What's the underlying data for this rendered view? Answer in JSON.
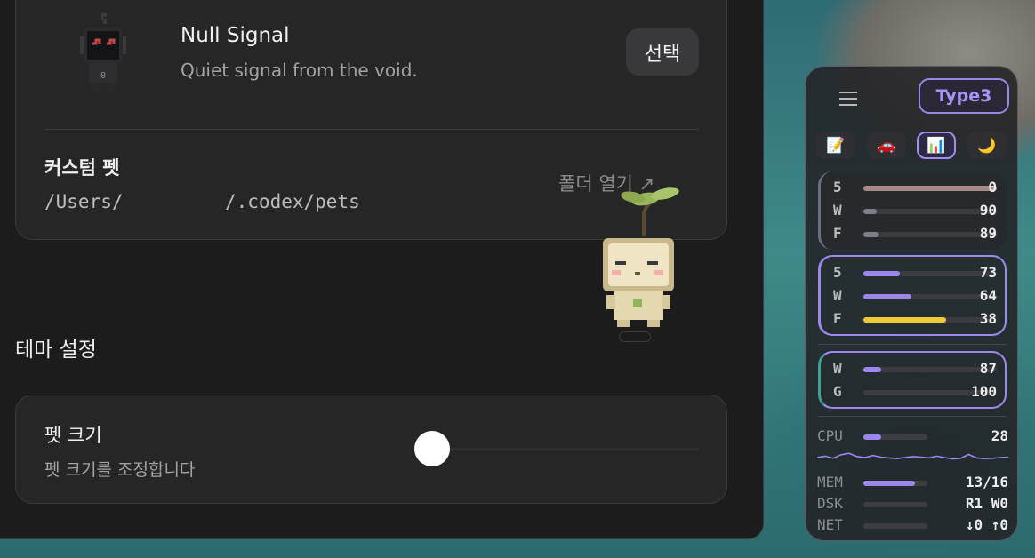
{
  "settings": {
    "pet": {
      "name": "Null Signal",
      "description": "Quiet signal from the void.",
      "select_label": "선택"
    },
    "custom_pet": {
      "title": "커스텀 펫",
      "path_prefix": "/Users/",
      "path_suffix": "/.codex/pets",
      "open_folder": "폴더 열기 ↗"
    },
    "theme_section_title": "테마 설정",
    "pet_size": {
      "title": "펫 크기",
      "description": "펫 크기를 조정합니다",
      "slider_value": 0
    }
  },
  "widget": {
    "type_label": "Type3",
    "tabs": [
      {
        "icon": "memo-icon",
        "glyph": "📝"
      },
      {
        "icon": "car-icon",
        "glyph": "🚗"
      },
      {
        "icon": "bar-chart-icon",
        "glyph": "📊",
        "active": true
      },
      {
        "icon": "moon-icon",
        "glyph": "🌙"
      }
    ],
    "group1": [
      {
        "label": "5",
        "value": "0",
        "fraction": 1.0,
        "color": "#a78a88"
      },
      {
        "label": "W",
        "value": "90",
        "fraction": 0.1,
        "color": "#807c8c"
      },
      {
        "label": "F",
        "value": "89",
        "fraction": 0.11,
        "color": "#807c8c"
      }
    ],
    "group2": [
      {
        "label": "5",
        "value": "73",
        "fraction": 0.27,
        "color": "#9b86ec"
      },
      {
        "label": "W",
        "value": "64",
        "fraction": 0.36,
        "color": "#9b86ec"
      },
      {
        "label": "F",
        "value": "38",
        "fraction": 0.62,
        "color": "#f0c93a"
      }
    ],
    "group3": [
      {
        "label": "W",
        "value": "87",
        "fraction": 0.13,
        "color": "#9b86ec"
      },
      {
        "label": "G",
        "value": "100",
        "fraction": 0.0,
        "color": "#9b86ec"
      }
    ],
    "system": {
      "cpu": {
        "label": "CPU",
        "value": "28",
        "fraction": 0.28
      },
      "mem": {
        "label": "MEM",
        "value": "13/16",
        "fraction": 0.81
      },
      "dsk": {
        "label": "DSK",
        "value": "R1 W0",
        "fraction": 0.0
      },
      "net": {
        "label": "NET",
        "value": "↓0 ↑0",
        "fraction": 0.0
      }
    },
    "cpu_history": [
      30,
      34,
      28,
      38,
      42,
      33,
      30,
      36,
      31,
      29,
      27,
      30,
      33,
      31,
      29,
      34,
      30,
      26,
      28,
      39,
      29,
      27,
      28,
      30,
      31
    ]
  }
}
